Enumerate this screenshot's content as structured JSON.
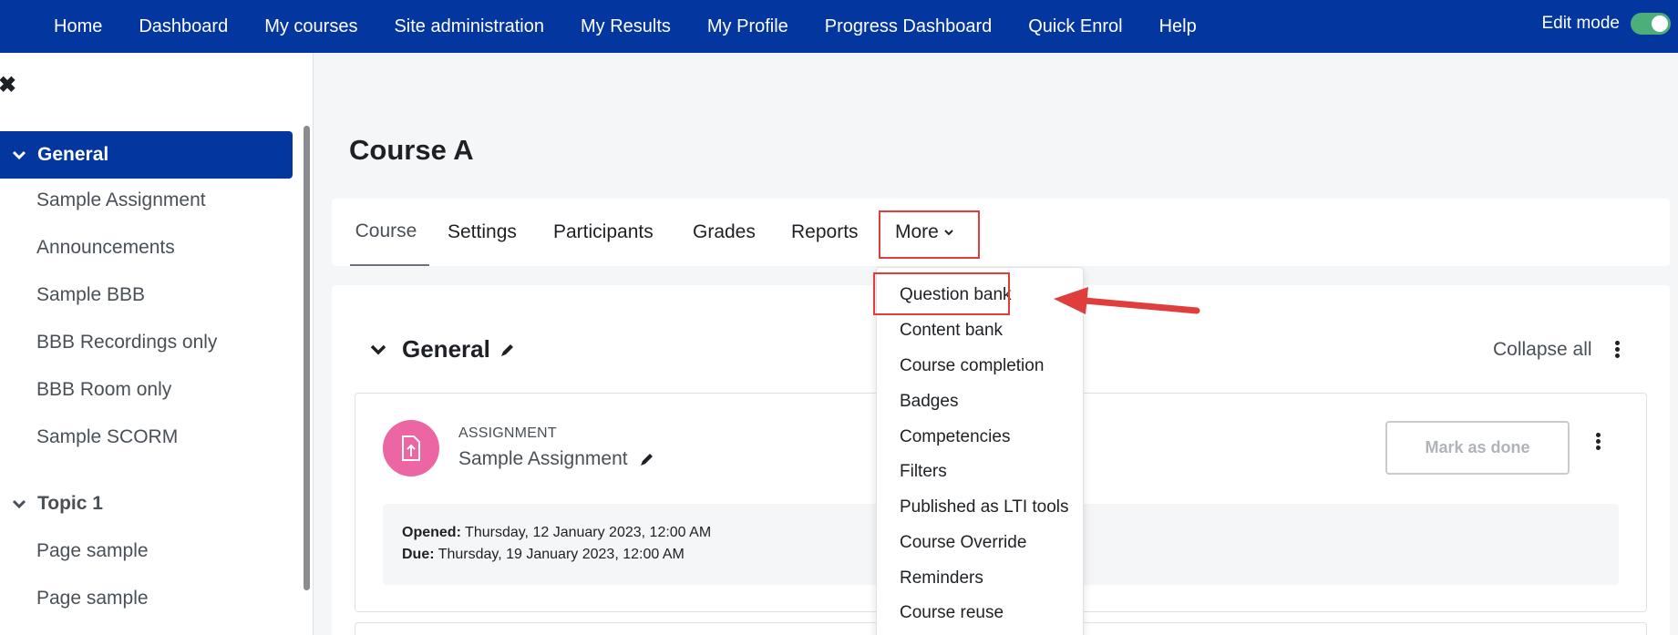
{
  "navbar": {
    "items": [
      "Home",
      "Dashboard",
      "My courses",
      "Site administration",
      "My Results",
      "My Profile",
      "Progress Dashboard",
      "Quick Enrol",
      "Help"
    ],
    "edit_mode_label": "Edit mode",
    "edit_mode_on": true
  },
  "drawer": {
    "close_icon": "close-icon",
    "active_section": "General",
    "general_items": [
      "Sample Assignment",
      "Announcements",
      "Sample BBB",
      "BBB Recordings only",
      "BBB Room only",
      "Sample SCORM"
    ],
    "topic_section": "Topic 1",
    "topic_items": [
      "Page sample",
      "Page sample"
    ]
  },
  "page": {
    "title": "Course A"
  },
  "secondary_nav": {
    "tabs": [
      "Course",
      "Settings",
      "Participants",
      "Grades",
      "Reports"
    ],
    "more_label": "More",
    "active_tab": "Course"
  },
  "more_menu": {
    "items": [
      "Question bank",
      "Content bank",
      "Course completion",
      "Badges",
      "Competencies",
      "Filters",
      "Published as LTI tools",
      "Course Override",
      "Reminders",
      "Course reuse"
    ],
    "highlighted": "Question bank"
  },
  "section": {
    "title": "General",
    "collapse_all": "Collapse all"
  },
  "activity": {
    "type": "ASSIGNMENT",
    "name": "Sample Assignment",
    "mark_done": "Mark as done",
    "opened_label": "Opened:",
    "opened_value": "Thursday, 12 January 2023, 12:00 AM",
    "due_label": "Due:",
    "due_value": "Thursday, 19 January 2023, 12:00 AM"
  },
  "colors": {
    "navbar": "#0436a0",
    "highlight": "#e03d3d",
    "assignment_icon": "#eb66a2",
    "toggle": "#4caf7a"
  }
}
